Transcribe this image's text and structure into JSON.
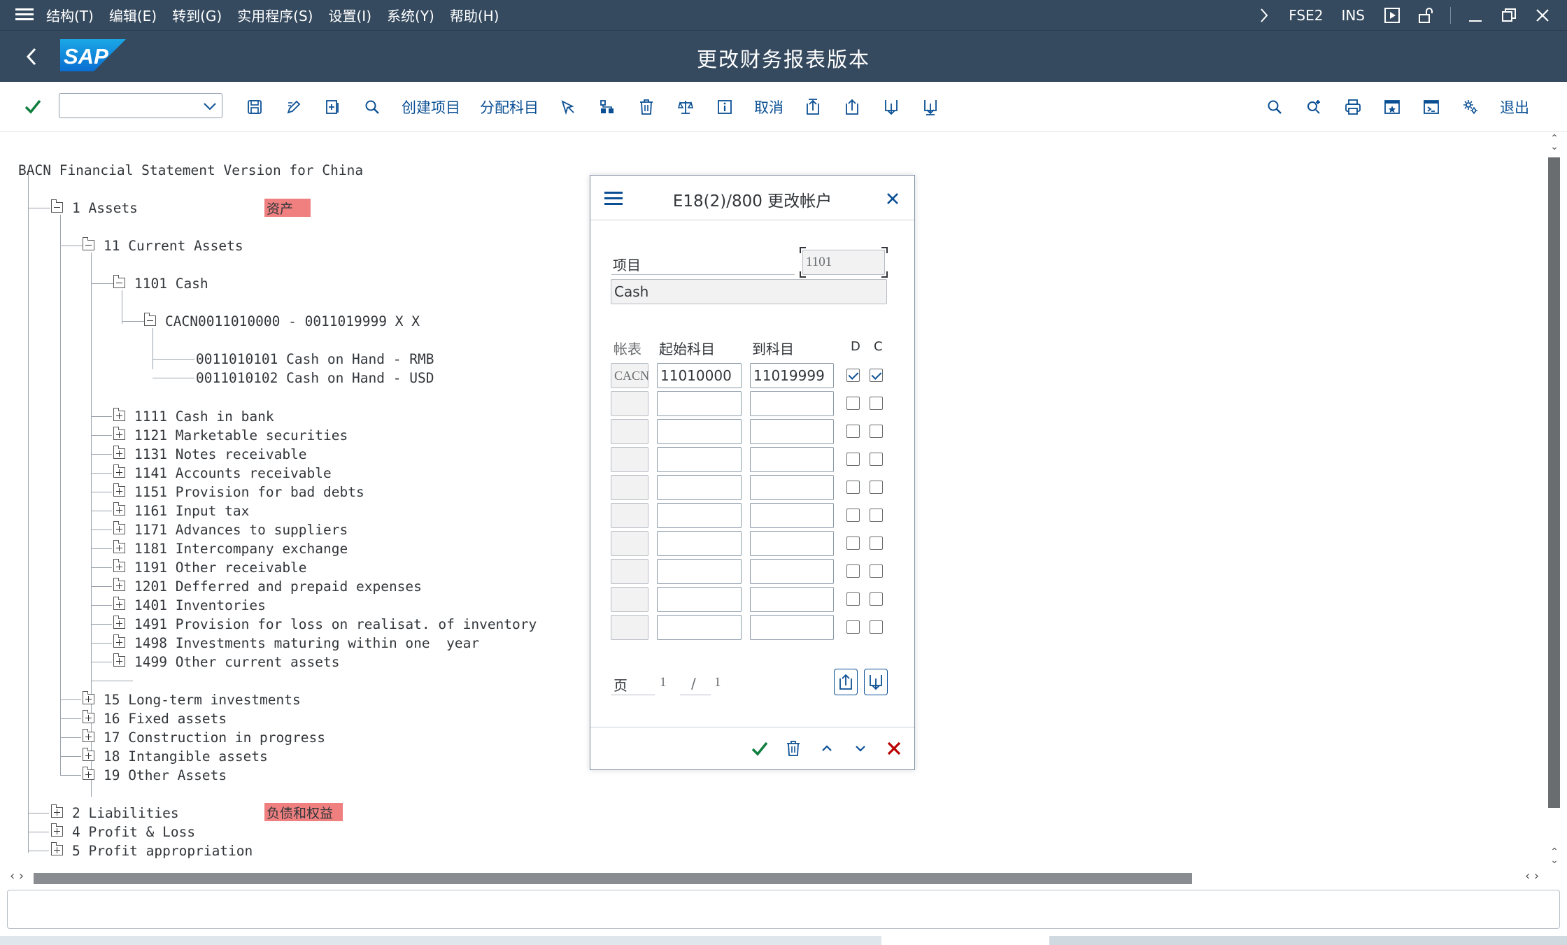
{
  "menubar": {
    "items": [
      "结构(T)",
      "编辑(E)",
      "转到(G)",
      "实用程序(S)",
      "设置(I)",
      "系统(Y)",
      "帮助(H)"
    ],
    "transaction": "FSE2",
    "mode": "INS"
  },
  "titlebar": {
    "logo_text": "SAP",
    "title": "更改财务报表版本"
  },
  "toolbar": {
    "command_field_value": "",
    "create_item_label": "创建项目",
    "assign_accounts_label": "分配科目",
    "cancel_label": "取消",
    "exit_label": "退出"
  },
  "tree": {
    "root": "BACN Financial Statement Version for China",
    "nodes": {
      "assets": "1 Assets",
      "current_assets": "11 Current Assets",
      "cash": "1101 Cash",
      "cacn_range": "CACN0011010000 - 0011019999 X X",
      "acct1": "0011010101 Cash on Hand - RMB",
      "acct2": "0011010102 Cash on Hand - USD",
      "n1111": "1111 Cash in bank",
      "n1121": "1121 Marketable securities",
      "n1131": "1131 Notes receivable",
      "n1141": "1141 Accounts receivable",
      "n1151": "1151 Provision for bad debts",
      "n1161": "1161 Input tax",
      "n1171": "1171 Advances to suppliers",
      "n1181": "1181 Intercompany exchange",
      "n1191": "1191 Other receivable",
      "n1201": "1201 Defferred and prepaid expenses",
      "n1401": "1401 Inventories",
      "n1491": "1491 Provision for loss on realisat. of inventory",
      "n1498": "1498 Investments maturing within one  year",
      "n1499": "1499 Other current assets",
      "n15": "15 Long-term investments",
      "n16": "16 Fixed assets",
      "n17": "17 Construction in progress",
      "n18": "18 Intangible assets",
      "n19": "19 Other Assets",
      "n2": "2 Liabilities",
      "n4": "4 Profit & Loss",
      "n5": "5 Profit appropriation"
    },
    "highlights": {
      "assets": "资产",
      "liabilities": "负债和权益"
    },
    "highlight_color": "#f08080"
  },
  "dialog": {
    "title": "E18(2)/800 更改帐户",
    "item_label": "项目",
    "item_value": "1101",
    "item_text": "Cash",
    "col_chart": "帐表",
    "col_from": "起始科目",
    "col_to": "到科目",
    "col_d": "D",
    "col_c": "C",
    "row1": {
      "chart": "CACN",
      "from": "11010000",
      "to": "11019999",
      "d": true,
      "c": true
    },
    "page_label": "页",
    "page_current": "1",
    "page_sep": "/",
    "page_total": "1"
  },
  "colors": {
    "shell": "#354a5f",
    "accent": "#0a4f94",
    "ok_green": "#107e3e",
    "cancel_red": "#bb0000"
  }
}
